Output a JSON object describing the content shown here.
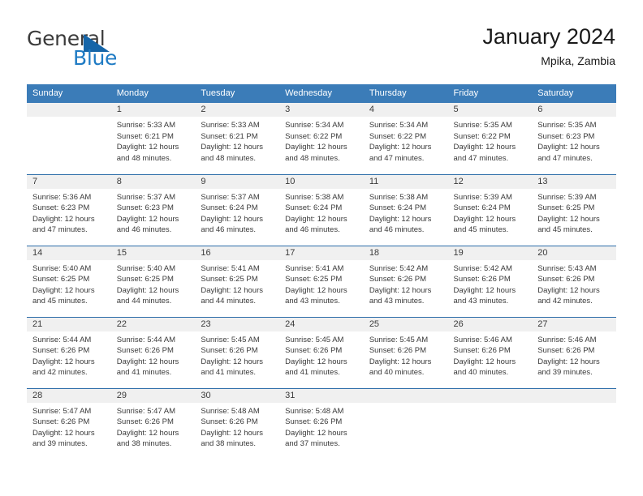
{
  "brand": {
    "name_top": "General",
    "name_bottom": "Blue",
    "color_dark": "#3b3b3b",
    "color_blue": "#1f7bc4",
    "triangle_color": "#1565a8"
  },
  "header": {
    "title": "January 2024",
    "subtitle": "Mpika, Zambia"
  },
  "theme": {
    "header_bg": "#3b7cb8",
    "row_divider": "#2b6ca8",
    "daynum_bg": "#f0f0f0",
    "text": "#3a3a3a"
  },
  "weekdays": [
    "Sunday",
    "Monday",
    "Tuesday",
    "Wednesday",
    "Thursday",
    "Friday",
    "Saturday"
  ],
  "labels": {
    "sunrise": "Sunrise:",
    "sunset": "Sunset:",
    "daylight": "Daylight:"
  },
  "weeks": [
    [
      {
        "day": "",
        "sunrise": "",
        "sunset": "",
        "daylight1": "",
        "daylight2": ""
      },
      {
        "day": "1",
        "sunrise": "Sunrise: 5:33 AM",
        "sunset": "Sunset: 6:21 PM",
        "daylight1": "Daylight: 12 hours",
        "daylight2": "and 48 minutes."
      },
      {
        "day": "2",
        "sunrise": "Sunrise: 5:33 AM",
        "sunset": "Sunset: 6:21 PM",
        "daylight1": "Daylight: 12 hours",
        "daylight2": "and 48 minutes."
      },
      {
        "day": "3",
        "sunrise": "Sunrise: 5:34 AM",
        "sunset": "Sunset: 6:22 PM",
        "daylight1": "Daylight: 12 hours",
        "daylight2": "and 48 minutes."
      },
      {
        "day": "4",
        "sunrise": "Sunrise: 5:34 AM",
        "sunset": "Sunset: 6:22 PM",
        "daylight1": "Daylight: 12 hours",
        "daylight2": "and 47 minutes."
      },
      {
        "day": "5",
        "sunrise": "Sunrise: 5:35 AM",
        "sunset": "Sunset: 6:22 PM",
        "daylight1": "Daylight: 12 hours",
        "daylight2": "and 47 minutes."
      },
      {
        "day": "6",
        "sunrise": "Sunrise: 5:35 AM",
        "sunset": "Sunset: 6:23 PM",
        "daylight1": "Daylight: 12 hours",
        "daylight2": "and 47 minutes."
      }
    ],
    [
      {
        "day": "7",
        "sunrise": "Sunrise: 5:36 AM",
        "sunset": "Sunset: 6:23 PM",
        "daylight1": "Daylight: 12 hours",
        "daylight2": "and 47 minutes."
      },
      {
        "day": "8",
        "sunrise": "Sunrise: 5:37 AM",
        "sunset": "Sunset: 6:23 PM",
        "daylight1": "Daylight: 12 hours",
        "daylight2": "and 46 minutes."
      },
      {
        "day": "9",
        "sunrise": "Sunrise: 5:37 AM",
        "sunset": "Sunset: 6:24 PM",
        "daylight1": "Daylight: 12 hours",
        "daylight2": "and 46 minutes."
      },
      {
        "day": "10",
        "sunrise": "Sunrise: 5:38 AM",
        "sunset": "Sunset: 6:24 PM",
        "daylight1": "Daylight: 12 hours",
        "daylight2": "and 46 minutes."
      },
      {
        "day": "11",
        "sunrise": "Sunrise: 5:38 AM",
        "sunset": "Sunset: 6:24 PM",
        "daylight1": "Daylight: 12 hours",
        "daylight2": "and 46 minutes."
      },
      {
        "day": "12",
        "sunrise": "Sunrise: 5:39 AM",
        "sunset": "Sunset: 6:24 PM",
        "daylight1": "Daylight: 12 hours",
        "daylight2": "and 45 minutes."
      },
      {
        "day": "13",
        "sunrise": "Sunrise: 5:39 AM",
        "sunset": "Sunset: 6:25 PM",
        "daylight1": "Daylight: 12 hours",
        "daylight2": "and 45 minutes."
      }
    ],
    [
      {
        "day": "14",
        "sunrise": "Sunrise: 5:40 AM",
        "sunset": "Sunset: 6:25 PM",
        "daylight1": "Daylight: 12 hours",
        "daylight2": "and 45 minutes."
      },
      {
        "day": "15",
        "sunrise": "Sunrise: 5:40 AM",
        "sunset": "Sunset: 6:25 PM",
        "daylight1": "Daylight: 12 hours",
        "daylight2": "and 44 minutes."
      },
      {
        "day": "16",
        "sunrise": "Sunrise: 5:41 AM",
        "sunset": "Sunset: 6:25 PM",
        "daylight1": "Daylight: 12 hours",
        "daylight2": "and 44 minutes."
      },
      {
        "day": "17",
        "sunrise": "Sunrise: 5:41 AM",
        "sunset": "Sunset: 6:25 PM",
        "daylight1": "Daylight: 12 hours",
        "daylight2": "and 43 minutes."
      },
      {
        "day": "18",
        "sunrise": "Sunrise: 5:42 AM",
        "sunset": "Sunset: 6:26 PM",
        "daylight1": "Daylight: 12 hours",
        "daylight2": "and 43 minutes."
      },
      {
        "day": "19",
        "sunrise": "Sunrise: 5:42 AM",
        "sunset": "Sunset: 6:26 PM",
        "daylight1": "Daylight: 12 hours",
        "daylight2": "and 43 minutes."
      },
      {
        "day": "20",
        "sunrise": "Sunrise: 5:43 AM",
        "sunset": "Sunset: 6:26 PM",
        "daylight1": "Daylight: 12 hours",
        "daylight2": "and 42 minutes."
      }
    ],
    [
      {
        "day": "21",
        "sunrise": "Sunrise: 5:44 AM",
        "sunset": "Sunset: 6:26 PM",
        "daylight1": "Daylight: 12 hours",
        "daylight2": "and 42 minutes."
      },
      {
        "day": "22",
        "sunrise": "Sunrise: 5:44 AM",
        "sunset": "Sunset: 6:26 PM",
        "daylight1": "Daylight: 12 hours",
        "daylight2": "and 41 minutes."
      },
      {
        "day": "23",
        "sunrise": "Sunrise: 5:45 AM",
        "sunset": "Sunset: 6:26 PM",
        "daylight1": "Daylight: 12 hours",
        "daylight2": "and 41 minutes."
      },
      {
        "day": "24",
        "sunrise": "Sunrise: 5:45 AM",
        "sunset": "Sunset: 6:26 PM",
        "daylight1": "Daylight: 12 hours",
        "daylight2": "and 41 minutes."
      },
      {
        "day": "25",
        "sunrise": "Sunrise: 5:45 AM",
        "sunset": "Sunset: 6:26 PM",
        "daylight1": "Daylight: 12 hours",
        "daylight2": "and 40 minutes."
      },
      {
        "day": "26",
        "sunrise": "Sunrise: 5:46 AM",
        "sunset": "Sunset: 6:26 PM",
        "daylight1": "Daylight: 12 hours",
        "daylight2": "and 40 minutes."
      },
      {
        "day": "27",
        "sunrise": "Sunrise: 5:46 AM",
        "sunset": "Sunset: 6:26 PM",
        "daylight1": "Daylight: 12 hours",
        "daylight2": "and 39 minutes."
      }
    ],
    [
      {
        "day": "28",
        "sunrise": "Sunrise: 5:47 AM",
        "sunset": "Sunset: 6:26 PM",
        "daylight1": "Daylight: 12 hours",
        "daylight2": "and 39 minutes."
      },
      {
        "day": "29",
        "sunrise": "Sunrise: 5:47 AM",
        "sunset": "Sunset: 6:26 PM",
        "daylight1": "Daylight: 12 hours",
        "daylight2": "and 38 minutes."
      },
      {
        "day": "30",
        "sunrise": "Sunrise: 5:48 AM",
        "sunset": "Sunset: 6:26 PM",
        "daylight1": "Daylight: 12 hours",
        "daylight2": "and 38 minutes."
      },
      {
        "day": "31",
        "sunrise": "Sunrise: 5:48 AM",
        "sunset": "Sunset: 6:26 PM",
        "daylight1": "Daylight: 12 hours",
        "daylight2": "and 37 minutes."
      },
      {
        "day": "",
        "sunrise": "",
        "sunset": "",
        "daylight1": "",
        "daylight2": ""
      },
      {
        "day": "",
        "sunrise": "",
        "sunset": "",
        "daylight1": "",
        "daylight2": ""
      },
      {
        "day": "",
        "sunrise": "",
        "sunset": "",
        "daylight1": "",
        "daylight2": ""
      }
    ]
  ]
}
